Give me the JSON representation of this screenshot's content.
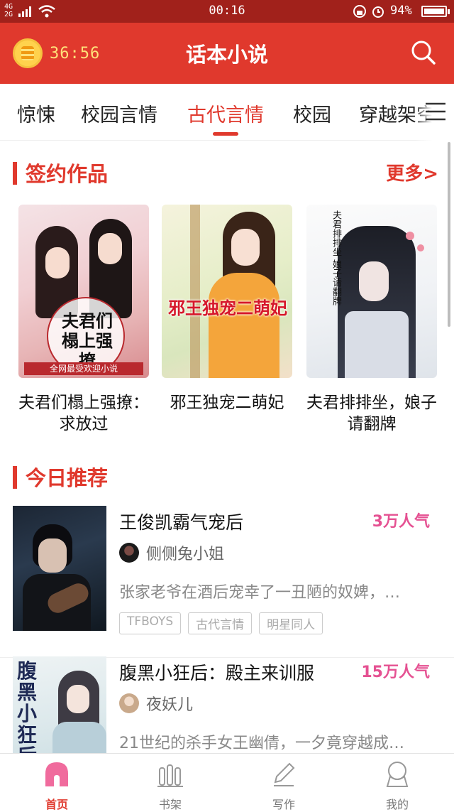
{
  "status_bar": {
    "network": [
      "4G",
      "2G"
    ],
    "time": "00:16",
    "battery_percent": "94%"
  },
  "header": {
    "timer": "36:56",
    "title": "话本小说",
    "icons": {
      "coin": "coin-clock-icon",
      "search": "search-icon"
    }
  },
  "tabs": {
    "items": [
      {
        "label": "惊悚",
        "active": false
      },
      {
        "label": "校园言情",
        "active": false
      },
      {
        "label": "古代言情",
        "active": true
      },
      {
        "label": "校园",
        "active": false
      },
      {
        "label": "穿越架空",
        "active": false
      }
    ],
    "menu_icon": "menu-icon",
    "accent_color": "#e0392d"
  },
  "signed_section": {
    "title": "签约作品",
    "more": "更多>",
    "books": [
      {
        "title": "夫君们榻上强撩：求放过",
        "cover_text": "夫君们榻上强撩",
        "cover_banner": "全网最受欢迎小说"
      },
      {
        "title": "邪王独宠二萌妃",
        "cover_text": "邪王独宠二萌妃"
      },
      {
        "title": "夫君排排坐，娘子请翻牌",
        "cover_text": "夫君排排坐 娘子请翻牌"
      }
    ]
  },
  "today_section": {
    "title": "今日推荐",
    "items": [
      {
        "title": "王俊凯霸气宠后",
        "popularity": "3万人气",
        "author": "侧侧兔小姐",
        "description": "张家老爷在酒后宠幸了一丑陋的奴婢，…",
        "tags": [
          "TFBOYS",
          "古代言情",
          "明星同人"
        ]
      },
      {
        "title": "腹黑小狂后：殿主来训服",
        "popularity": "15万人气",
        "author": "夜妖儿",
        "description": "21世纪的杀手女王幽倩，一夕竟穿越成…",
        "cover_text": "腹黑小狂后"
      }
    ]
  },
  "bottom_nav": [
    {
      "label": "首页",
      "icon": "home-icon",
      "active": true
    },
    {
      "label": "书架",
      "icon": "bookshelf-icon",
      "active": false
    },
    {
      "label": "写作",
      "icon": "pencil-icon",
      "active": false
    },
    {
      "label": "我的",
      "icon": "profile-icon",
      "active": false
    }
  ]
}
